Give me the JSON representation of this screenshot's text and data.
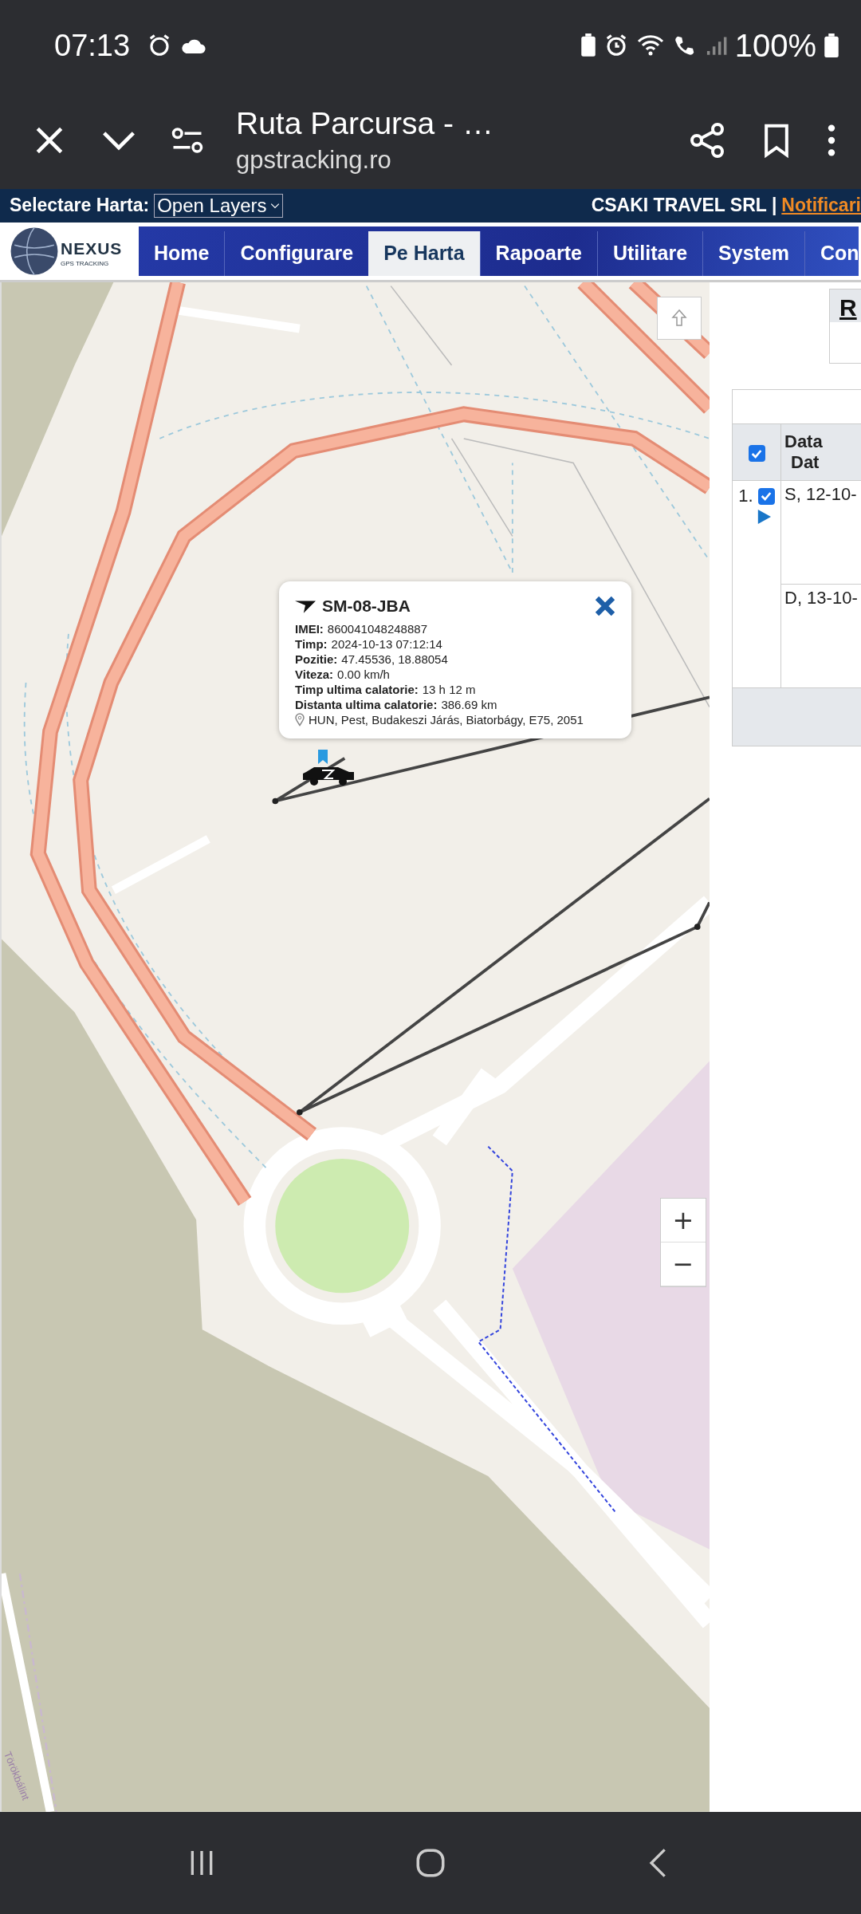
{
  "status_bar": {
    "time": "07:13",
    "battery": "100%"
  },
  "browser": {
    "title": "Ruta Parcursa - …",
    "url": "gpstracking.ro"
  },
  "header": {
    "map_label": "Selectare Harta:",
    "map_select": "Open Layers",
    "company": "CSAKI TRAVEL SRL",
    "separator": "|",
    "notifications_link": "Notificari"
  },
  "logo": {
    "name": "NEXUS",
    "tagline": "GPS TRACKING"
  },
  "nav": [
    {
      "label": "Home",
      "selected": false
    },
    {
      "label": "Configurare",
      "selected": false
    },
    {
      "label": "Pe Harta",
      "selected": true
    },
    {
      "label": "Rapoarte",
      "selected": false
    },
    {
      "label": "Utilitare",
      "selected": false
    },
    {
      "label": "System",
      "selected": false
    },
    {
      "label": "Con",
      "selected": false
    }
  ],
  "map": {
    "place_label": "Törökbálint",
    "zoom_controls": [
      "+",
      "−"
    ],
    "popup": {
      "vehicle": "SM-08-JBA",
      "fields": [
        {
          "label": "IMEI:",
          "value": "860041048248887"
        },
        {
          "label": "Timp:",
          "value": "2024-10-13 07:12:14"
        },
        {
          "label": "Pozitie:",
          "value": "47.45536, 18.88054"
        },
        {
          "label": "Viteza:",
          "value": "0.00 km/h"
        },
        {
          "label": "Timp ultima calatorie:",
          "value": "13 h 12 m"
        },
        {
          "label": "Distanta ultima calatorie:",
          "value": "386.69 km"
        }
      ],
      "address": "HUN, Pest, Budakeszi Járás, Biatorbágy, E75, 2051"
    }
  },
  "side_panel": {
    "heading": "R",
    "table": {
      "select_all_checked": true,
      "column_2": [
        "Data",
        "Dat"
      ],
      "rows": [
        {
          "index": "1.",
          "checked": true,
          "entries": [
            "S, 12-10-",
            "D, 13-10-"
          ]
        }
      ]
    }
  }
}
